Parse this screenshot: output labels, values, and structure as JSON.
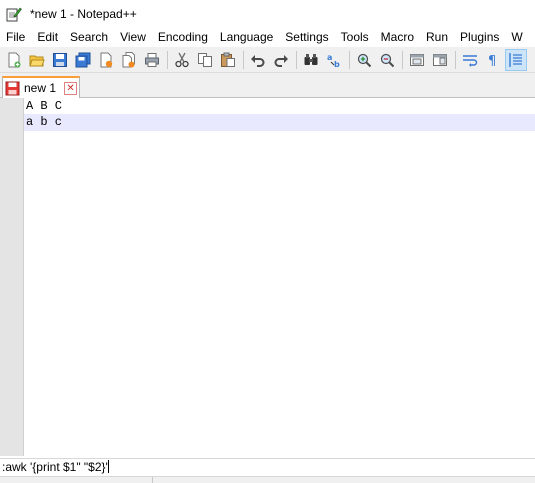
{
  "window": {
    "title": "*new 1 - Notepad++"
  },
  "menu": [
    "File",
    "Edit",
    "Search",
    "View",
    "Encoding",
    "Language",
    "Settings",
    "Tools",
    "Macro",
    "Run",
    "Plugins",
    "W"
  ],
  "toolbar": {
    "buttons": [
      "new-file-icon",
      "open-file-icon",
      "save-icon",
      "save-all-icon",
      "close-icon",
      "close-all-icon",
      "print-icon",
      "cut-icon",
      "copy-icon",
      "paste-icon",
      "undo-icon",
      "redo-icon",
      "find-icon",
      "replace-icon",
      "zoom-in-icon",
      "zoom-out-icon",
      "sync-vertical-icon",
      "sync-horizontal-icon",
      "word-wrap-icon",
      "show-all-chars-icon",
      "indent-guide-icon"
    ]
  },
  "tabs": [
    {
      "label": "new 1",
      "close_glyph": "✕"
    }
  ],
  "editor": {
    "lines": [
      "A B C",
      "a b c"
    ],
    "current_line_index": 1
  },
  "command_line": {
    "text": ":awk '{print $1\" \"$2}'"
  },
  "colors": {
    "current_line": "#e8e8ff",
    "tab_accent": "#fa9e39",
    "gutter": "#e4e4e4",
    "toolbar_bg": "#f0f0f0"
  }
}
